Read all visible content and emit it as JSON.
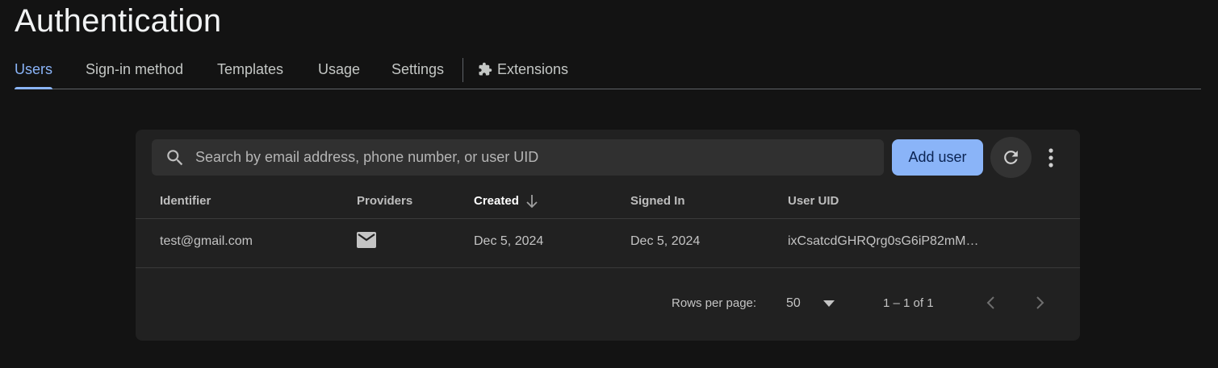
{
  "page": {
    "title": "Authentication"
  },
  "tabs": [
    {
      "label": "Users",
      "active": true
    },
    {
      "label": "Sign-in method",
      "active": false
    },
    {
      "label": "Templates",
      "active": false
    },
    {
      "label": "Usage",
      "active": false
    },
    {
      "label": "Settings",
      "active": false
    },
    {
      "label": "Extensions",
      "active": false,
      "icon": "extension-puzzle-icon"
    }
  ],
  "toolbar": {
    "search_placeholder": "Search by email address, phone number, or user UID",
    "search_value": "",
    "add_user_label": "Add user",
    "refresh_icon": "refresh-icon",
    "more_icon": "more-vert-icon"
  },
  "table": {
    "columns": [
      {
        "label": "Identifier"
      },
      {
        "label": "Providers"
      },
      {
        "label": "Created",
        "sorted": "descending"
      },
      {
        "label": "Signed In"
      },
      {
        "label": "User UID"
      }
    ],
    "rows": [
      {
        "identifier": "test@gmail.com",
        "provider_icon": "email-icon",
        "created": "Dec 5, 2024",
        "signed_in": "Dec 5, 2024",
        "uid": "ixCsatcdGHRQrg0sG6iP82mM…"
      }
    ]
  },
  "pagination": {
    "rows_per_page_label": "Rows per page:",
    "rows_per_page_value": "50",
    "range_label": "1 – 1 of 1"
  },
  "colors": {
    "accent": "#8ab4f8",
    "background": "#131313",
    "card": "#212121"
  }
}
